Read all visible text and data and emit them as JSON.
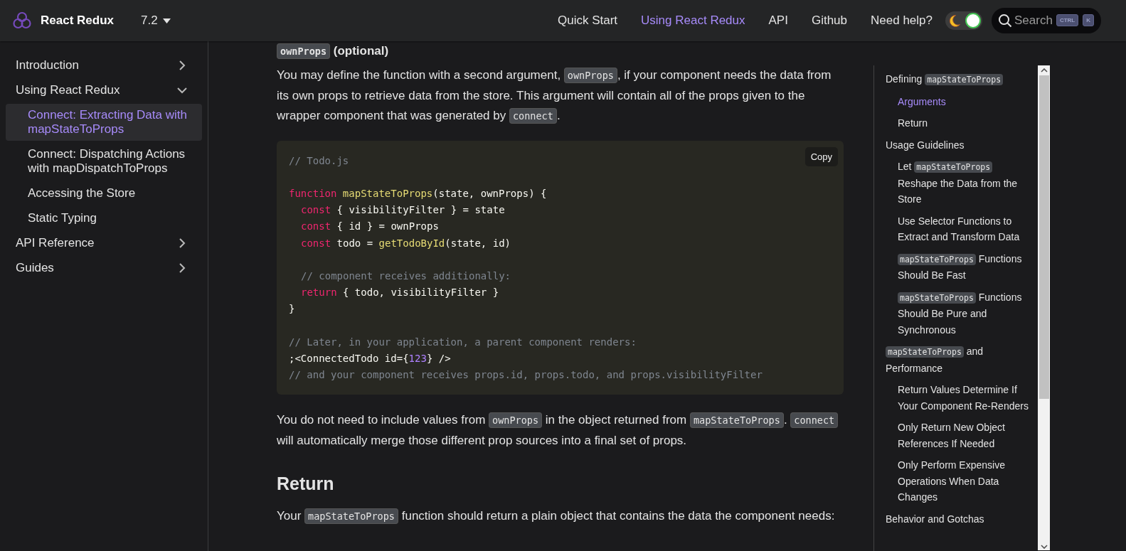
{
  "navbar": {
    "brand": "React Redux",
    "version": "7.2",
    "links": [
      {
        "label": "Quick Start",
        "selected": false
      },
      {
        "label": "Using React Redux",
        "selected": true
      },
      {
        "label": "API",
        "selected": false
      },
      {
        "label": "Github",
        "selected": false
      },
      {
        "label": "Need help?",
        "selected": false
      }
    ],
    "theme_toggle": {
      "on": true
    },
    "search": {
      "placeholder": "Search",
      "keys": [
        "CTRL",
        "K"
      ]
    }
  },
  "sidebar": {
    "items": [
      {
        "label": "Introduction",
        "expanded": false
      },
      {
        "label": "Using React Redux",
        "expanded": true,
        "children": [
          {
            "label": "Connect: Extracting Data with mapStateToProps",
            "selected": true
          },
          {
            "label": "Connect: Dispatching Actions with mapDispatchToProps",
            "selected": false
          },
          {
            "label": "Accessing the Store",
            "selected": false
          },
          {
            "label": "Static Typing",
            "selected": false
          }
        ]
      },
      {
        "label": "API Reference",
        "expanded": false
      },
      {
        "label": "Guides",
        "expanded": false
      }
    ]
  },
  "content": [
    {
      "kind": "h3",
      "segments": [
        {
          "code": "ownProps"
        },
        " (optional)"
      ]
    },
    {
      "kind": "p",
      "segments": [
        "You may define the function with a second argument, ",
        {
          "code": "ownProps"
        },
        ", if your component needs the data from its own props to retrieve data from the store. This argument will contain all of the props given to the wrapper component that was generated by ",
        {
          "code": "connect"
        },
        "."
      ]
    },
    {
      "kind": "code",
      "copy": "Copy",
      "lines": [
        {
          "indent": false,
          "blank_before": false,
          "tokens": [
            {
              "text": "// Todo.js",
              "kind": "comment"
            }
          ]
        },
        {
          "indent": false,
          "blank_before": true,
          "tokens": [
            {
              "text": "function",
              "kind": "keyword"
            },
            {
              "text": "mapStateToProps",
              "kind": "function",
              "space": true
            },
            {
              "text": "(state, ownProps) {",
              "kind": "plain"
            }
          ]
        },
        {
          "indent": true,
          "blank_before": false,
          "tokens": [
            {
              "text": "const",
              "kind": "keyword"
            },
            {
              "text": "{ visibilityFilter } = state",
              "kind": "plain",
              "space": true
            }
          ]
        },
        {
          "indent": true,
          "blank_before": false,
          "tokens": [
            {
              "text": "const",
              "kind": "keyword"
            },
            {
              "text": "{ id } = ownProps",
              "kind": "plain",
              "space": true
            }
          ]
        },
        {
          "indent": true,
          "blank_before": false,
          "tokens": [
            {
              "text": "const",
              "kind": "keyword"
            },
            {
              "text": "todo =",
              "kind": "plain",
              "space": true
            },
            {
              "text": "getTodoById",
              "kind": "function",
              "space": true
            },
            {
              "text": "(state, id)",
              "kind": "plain"
            }
          ]
        },
        {
          "indent": true,
          "blank_before": true,
          "tokens": [
            {
              "text": "// component receives additionally:",
              "kind": "comment"
            }
          ]
        },
        {
          "indent": true,
          "blank_before": false,
          "tokens": [
            {
              "text": "return",
              "kind": "keyword"
            },
            {
              "text": "{ todo, visibilityFilter }",
              "kind": "plain",
              "space": true
            }
          ]
        },
        {
          "indent": false,
          "blank_before": false,
          "tokens": [
            {
              "text": "}",
              "kind": "plain"
            }
          ]
        },
        {
          "indent": false,
          "blank_before": true,
          "tokens": [
            {
              "text": "// Later, in your application, a parent component renders:",
              "kind": "comment"
            }
          ]
        },
        {
          "indent": false,
          "blank_before": false,
          "tokens": [
            {
              "text": ";<ConnectedTodo id={",
              "kind": "plain"
            },
            {
              "text": "123",
              "kind": "number"
            },
            {
              "text": "} />",
              "kind": "plain"
            }
          ]
        },
        {
          "indent": false,
          "blank_before": false,
          "tokens": [
            {
              "text": "// and your component receives props.id, props.todo, and props.visibilityFilter",
              "kind": "comment"
            }
          ]
        }
      ]
    },
    {
      "kind": "p",
      "segments": [
        "You do not need to include values from ",
        {
          "code": "ownProps"
        },
        " in the object returned from ",
        {
          "code": "mapStateToProps"
        },
        ". ",
        {
          "code": "connect"
        },
        " will automatically merge those different prop sources into a final set of props."
      ]
    },
    {
      "kind": "h2",
      "segments": [
        "Return"
      ]
    },
    {
      "kind": "p",
      "segments": [
        "Your ",
        {
          "code": "mapStateToProps"
        },
        " function should return a plain object that contains the data the component needs:"
      ]
    }
  ],
  "toc": [
    {
      "segments": [
        "Defining ",
        {
          "code": "mapStateToProps"
        }
      ],
      "selected": false,
      "children": [
        {
          "segments": [
            "Arguments"
          ],
          "selected": true
        },
        {
          "segments": [
            "Return"
          ],
          "selected": false
        }
      ]
    },
    {
      "segments": [
        "Usage Guidelines"
      ],
      "selected": false,
      "children": [
        {
          "segments": [
            "Let ",
            {
              "code": "mapStateToProps"
            },
            " Reshape the Data from the Store"
          ],
          "selected": false
        },
        {
          "segments": [
            "Use Selector Functions to Extract and Transform Data"
          ],
          "selected": false
        },
        {
          "segments": [
            {
              "code": "mapStateToProps"
            },
            " Functions Should Be Fast"
          ],
          "selected": false
        },
        {
          "segments": [
            {
              "code": "mapStateToProps"
            },
            " Functions Should Be Pure and Synchronous"
          ],
          "selected": false
        }
      ]
    },
    {
      "segments": [
        {
          "code": "mapStateToProps"
        },
        " and Performance"
      ],
      "selected": false,
      "children": [
        {
          "segments": [
            "Return Values Determine If Your Component Re-Renders"
          ],
          "selected": false
        },
        {
          "segments": [
            "Only Return New Object References If Needed"
          ],
          "selected": false
        },
        {
          "segments": [
            "Only Perform Expensive Operations When Data Changes"
          ],
          "selected": false
        }
      ]
    },
    {
      "segments": [
        "Behavior and Gotchas"
      ],
      "selected": false
    }
  ]
}
